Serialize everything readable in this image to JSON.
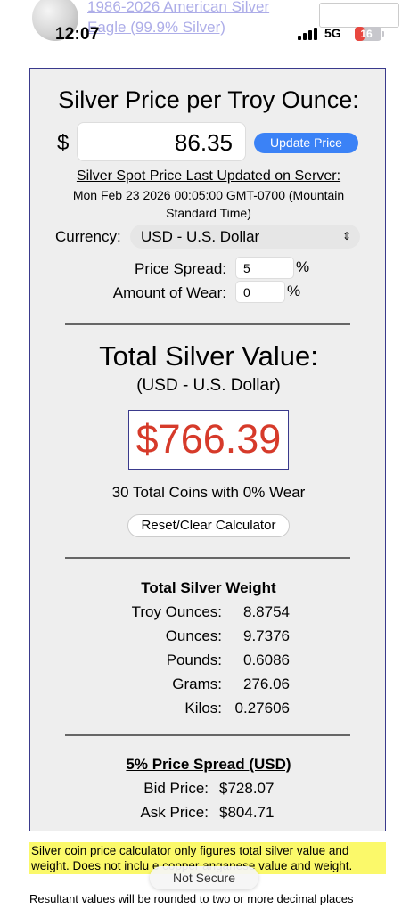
{
  "background_link": {
    "text": "1986-2026   American Silver Eagle (99.9% Silver)"
  },
  "status_bar": {
    "time": "12:07",
    "network": "5G",
    "battery": "16",
    "battery_level": 0.16
  },
  "calculator": {
    "heading": "Silver Price per Troy Ounce:",
    "currency_symbol": "$",
    "price_value": "86.35",
    "update_button": "Update Price",
    "spot_updated_label": "Silver Spot Price Last Updated on Server:",
    "spot_updated_time": "Mon Feb 23 2026 00:05:00 GMT-0700 (Mountain Standard Time)",
    "currency_label": "Currency:",
    "currency_value": "USD - U.S. Dollar",
    "price_spread_label": "Price Spread:",
    "price_spread_value": "5",
    "amount_of_wear_label": "Amount of Wear:",
    "amount_of_wear_value": "0",
    "percent_sign": "%",
    "total_heading": "Total Silver Value:",
    "total_currency": "(USD - U.S. Dollar)",
    "total_value": "$766.39",
    "coins_summary": "30 Total Coins with 0% Wear",
    "reset_button": "Reset/Clear Calculator",
    "weight_heading": "Total Silver Weight",
    "weights": [
      {
        "label": "Troy Ounces:",
        "value": "8.8754"
      },
      {
        "label": "Ounces:",
        "value": "9.7376"
      },
      {
        "label": "Pounds:",
        "value": "0.6086"
      },
      {
        "label": "Grams:",
        "value": "276.06"
      },
      {
        "label": "Kilos:",
        "value": "0.27606"
      }
    ],
    "spread_heading": "5% Price Spread (USD)",
    "bid_label": "Bid Price:",
    "bid_value": "$728.07",
    "ask_label": "Ask Price:",
    "ask_value": "$804.71"
  },
  "footer": {
    "note": "Silver coin price calculator only figures total silver value and weight. Does not inclu   e   copper     anganese value and weight.",
    "not_secure_badge": "Not Secure",
    "rounding_note": "Resultant values will be rounded to two or more decimal places"
  }
}
